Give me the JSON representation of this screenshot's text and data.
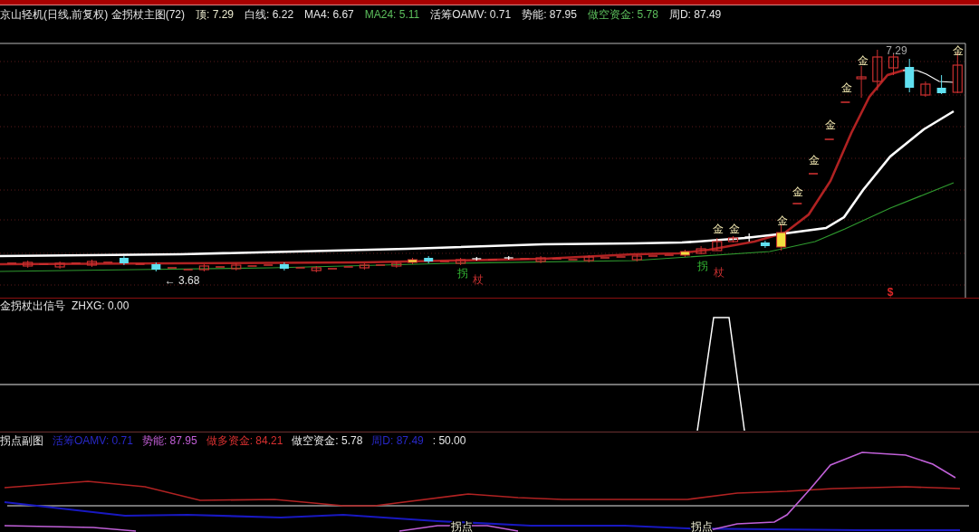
{
  "main_panel": {
    "title": "京山轻机(日线,前复权) 金拐杖主图(72)",
    "readings": [
      {
        "text": "顶: 7.29",
        "color": "#ecebcf"
      },
      {
        "text": "白线: 6.22",
        "color": "#e6e6e6"
      },
      {
        "text": "MA4: 6.67",
        "color": "#e6e6e6"
      },
      {
        "text": "MA24: 5.11",
        "color": "#5cbf5c"
      },
      {
        "text": "活筹OAMV: 0.71",
        "color": "#e6e6e6"
      },
      {
        "text": "势能: 87.95",
        "color": "#e6e6e6"
      },
      {
        "text": "做空资金: 5.78",
        "color": "#5cbf5c"
      },
      {
        "text": "周D: 87.49",
        "color": "#e6e6e6"
      }
    ],
    "annotations": [
      {
        "kind": "low",
        "text": "← 3.68"
      },
      {
        "kind": "turn",
        "text": "拐"
      },
      {
        "kind": "staff",
        "text": "杖"
      },
      {
        "kind": "turn",
        "text": "拐"
      },
      {
        "kind": "gold",
        "text": "金"
      },
      {
        "kind": "staff",
        "text": "杖"
      },
      {
        "kind": "gold",
        "text": "金"
      },
      {
        "kind": "gold",
        "text": "金"
      },
      {
        "kind": "gold",
        "text": "金"
      },
      {
        "kind": "gold",
        "text": "金"
      },
      {
        "kind": "gold",
        "text": "金"
      },
      {
        "kind": "gold",
        "text": "金"
      },
      {
        "kind": "gold",
        "text": "金"
      },
      {
        "kind": "sell",
        "text": "$"
      },
      {
        "kind": "peak",
        "text": "7.29"
      },
      {
        "kind": "gold",
        "text": "金"
      }
    ]
  },
  "signal_panel": {
    "title": "金拐杖出信号",
    "readings": [
      {
        "text": "ZHXG: 0.00",
        "color": "#e6e6e6"
      }
    ]
  },
  "sub_panel": {
    "title": "拐点副图",
    "readings": [
      {
        "text": "活筹OAMV: 0.71",
        "color": "#2828c8"
      },
      {
        "text": "势能: 87.95",
        "color": "#c45fd8"
      },
      {
        "text": "做多资金: 84.21",
        "color": "#d83030"
      },
      {
        "text": "做空资金: 5.78",
        "color": "#e6e6e6"
      },
      {
        "text": "周D: 87.49",
        "color": "#2828c8"
      },
      {
        "text": ": 50.00",
        "color": "#e6e6e6"
      }
    ],
    "annotations": [
      {
        "kind": "turn_point",
        "text": "拐点"
      },
      {
        "kind": "turn_point",
        "text": "拐点"
      }
    ]
  }
}
